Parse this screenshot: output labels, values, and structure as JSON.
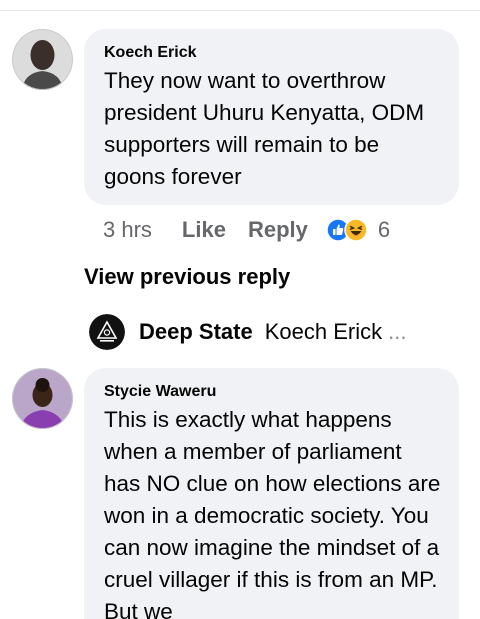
{
  "comments": [
    {
      "author": "Koech Erick",
      "text": "They now want to overthrow president Uhuru Kenyatta, ODM supporters will remain to be goons forever",
      "time": "3 hrs",
      "like_label": "Like",
      "reply_label": "Reply",
      "reaction_count": "6",
      "reactions": [
        "like-icon",
        "haha-icon"
      ]
    },
    {
      "author": "Stycie Waweru",
      "text": "This is exactly what happens when a member of parliament has NO clue on how elections are won in a democratic society. You can now imagine the mindset of a cruel villager if this is from an MP. But we"
    }
  ],
  "view_previous_reply": "View previous reply",
  "reply_preview": {
    "author": "Deep State",
    "snippet": "Koech Erick",
    "ellipsis": "..."
  },
  "colors": {
    "bubble": "#f0f2f5",
    "secondary_text": "#65676b",
    "like_blue": "#1877f2",
    "haha_yellow": "#f7b928"
  }
}
